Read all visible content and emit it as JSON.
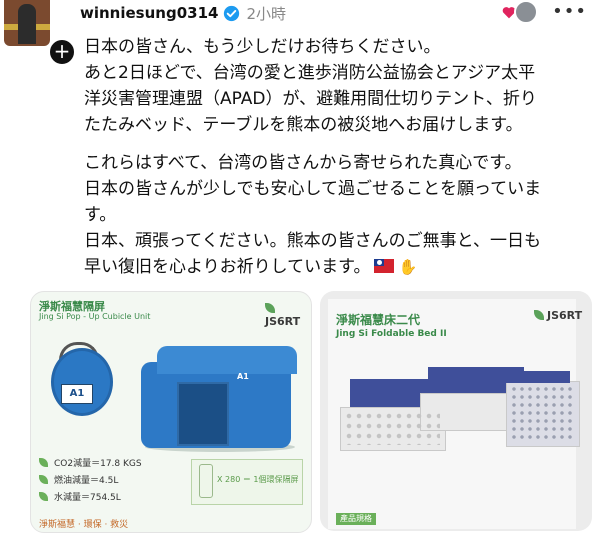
{
  "post": {
    "username": "winniesung0314",
    "time_ago": "2小時",
    "more": "•••",
    "paragraphs": [
      [
        "日本の皆さん、もう少しだけお待ちください。",
        "あと2日ほどで、台湾の愛と進歩消防公益協会とアジア太平",
        "洋災害管理連盟（APAD）が、避難用間仕切りテント、折り",
        "たたみベッド、テーブルを熊本の被災地へお届けします。"
      ],
      [
        "これらはすべて、台湾の皆さんから寄せられた真心です。",
        "日本の皆さんが少しでも安心して過ごせることを願っていま",
        "す。",
        "日本、頑張ってください。熊本の皆さんのご無事と、一日も",
        "早い復旧を心よりお祈りしています。"
      ]
    ]
  },
  "card1": {
    "title": "淨斯福慧隔屏",
    "subtitle": "Jing Si Pop - Up Cubicle Unit",
    "logo": "JS6RT",
    "bag_label": "A1",
    "tent_label": "A1",
    "stats": [
      "CO2減量＝17.8 KGS",
      "燃油減量＝4.5L",
      "水減量＝754.5L"
    ],
    "equation": "X 280 ＝ 1個環保隔屏",
    "bottom": "淨斯福慧 · 環保 · 救災"
  },
  "card2": {
    "title": "淨斯福慧床二代",
    "subtitle": "Jing Si  Foldable Bed II",
    "logo": "JS6RT",
    "tag": "產品規格"
  },
  "colors": {
    "accent": "#3a8a4a",
    "verified": "#1d9bf0",
    "tent": "#2d79c6",
    "bed": "#3f4f9a"
  }
}
